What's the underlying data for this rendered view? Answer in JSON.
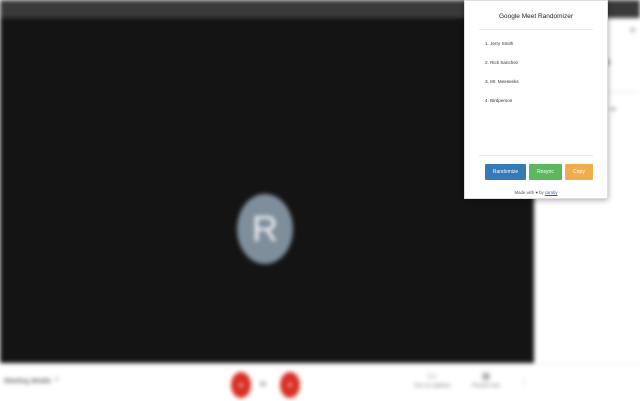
{
  "meeting": {
    "avatar_letter": "R",
    "bottom": {
      "meeting_details_label": "Meeting details",
      "turn_on_captions_label": "Turn on captions",
      "present_now_label": "Present now"
    }
  },
  "popup": {
    "title": "Google Meet Randomizer",
    "participants": [
      "1. Jerry Smith",
      "2. Rick Sanchez",
      "3. Mr. Meeseeks",
      "4. Birdperson"
    ],
    "buttons": {
      "randomize": "Randomize",
      "resync": "Resync",
      "copy": "Copy"
    },
    "footer": {
      "prefix": "Made with",
      "heart": "♥",
      "by": "by",
      "author": "camby"
    }
  },
  "colors": {
    "randomize": "#337ab7",
    "resync": "#5cb85c",
    "copy": "#f0ad4e",
    "control_red": "#d93025"
  }
}
